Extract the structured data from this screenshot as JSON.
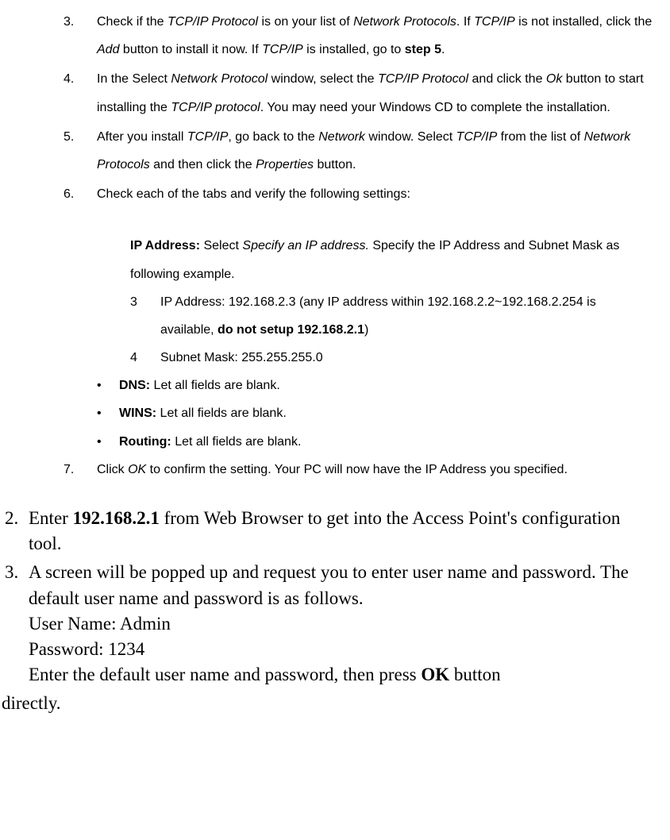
{
  "inner": {
    "s3": {
      "num": "3.",
      "t1": "Check if the ",
      "i1": "TCP/IP Protocol",
      "t2": " is on your list of ",
      "i2": "Network Protocols",
      "t3": ". If ",
      "i3": "TCP/IP",
      "t4": " is not installed, click the ",
      "i4": "Add",
      "t5": " button to install it now. If ",
      "i5": "TCP/IP",
      "t6": " is installed, go to ",
      "b1": "step 5",
      "t7": "."
    },
    "s4": {
      "num": "4.",
      "t1": "In the Select ",
      "i1": "Network Protocol",
      "t2": " window, select the ",
      "i2": "TCP/IP Protocol",
      "t3": " and click the ",
      "i3": "Ok",
      "t4": "        button to start installing the ",
      "i4": "TCP/IP protocol",
      "t5": ". You may need your Windows CD to        complete the installation."
    },
    "s5": {
      "num": "5.",
      "t1": "After you install ",
      "i1": "TCP/IP",
      "t2": ", go back to the ",
      "i2": "Network",
      "t3": " window. Select ",
      "i3": "TCP/IP",
      "t4": " from the list of ",
      "i4": "Network Protocols",
      "t5": " and then click the ",
      "i5": "Properties",
      "t6": " button."
    },
    "s6": {
      "num": "6.",
      "t1": "Check each of the tabs and verify the following settings:"
    },
    "ip": {
      "b1": "IP Address:",
      "t1": " Select ",
      "i1": "Specify an IP address.",
      "t2": " Specify the IP Address and Subnet Mask as following example."
    },
    "sub3": {
      "num": "3",
      "t1": "IP Address: 192.168.2.3 (any IP address within 192.168.2.2~192.168.2.254 is available, ",
      "b1": "do not setup 192.168.2.1",
      "t2": ")"
    },
    "sub4": {
      "num": "4",
      "t1": "Subnet Mask: 255.255.255.0"
    },
    "dns": {
      "b": "DNS:",
      "t": " Let all fields are blank."
    },
    "wins": {
      "b": "WINS:",
      "t": " Let all fields are blank."
    },
    "routing": {
      "b": "Routing:",
      "t": " Let all fields are blank."
    },
    "s7": {
      "num": "7.",
      "t1": "Click ",
      "i1": "OK",
      "t2": " to confirm the setting. Your PC will now have the IP Address you specified."
    }
  },
  "outer": {
    "o2": {
      "num": "2.",
      "t1": "Enter ",
      "b1": "192.168.2.1",
      "t2": " from Web Browser to get into the Access Point's configuration tool."
    },
    "o3": {
      "num": "3.",
      "t1": "A screen will be popped up and request you to enter user name and password. The default user name and password is as follows.",
      "line2": "User Name: Admin",
      "line3": "Password: 1234",
      "t4a": "Enter the default user name and password, then press ",
      "b4": "OK",
      "t4b": " button"
    },
    "last": "directly."
  },
  "bullet": "•"
}
